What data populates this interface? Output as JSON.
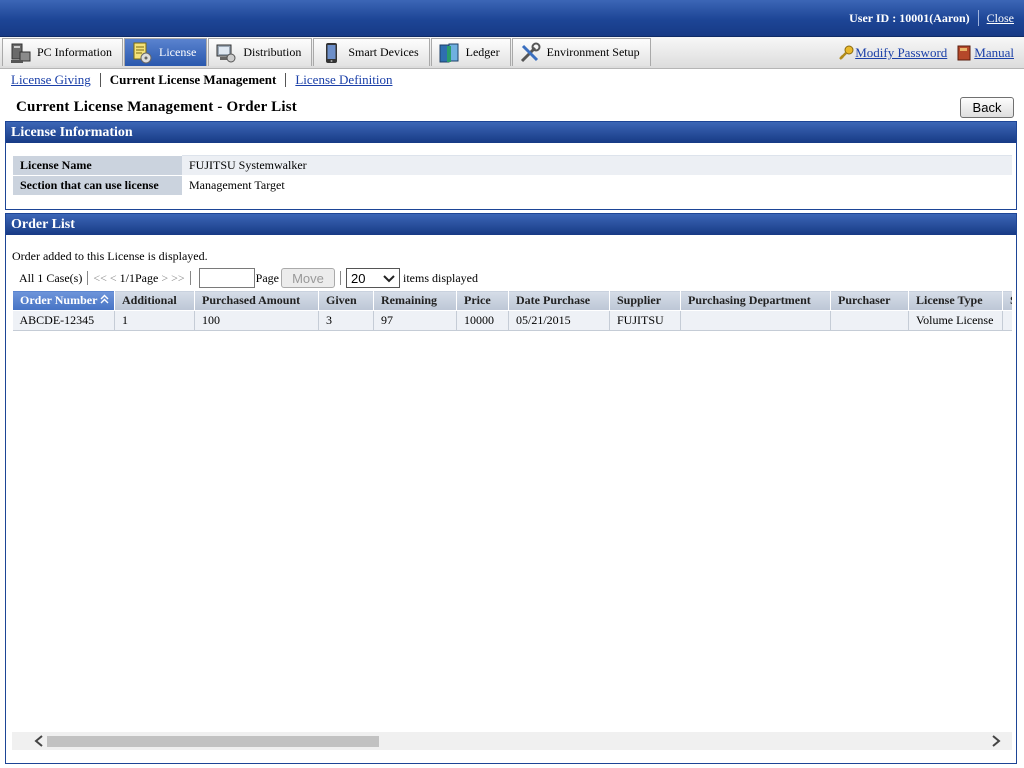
{
  "header": {
    "user_id": "User ID : 10001(Aaron)",
    "close": "Close"
  },
  "nav": {
    "tabs": [
      {
        "label": "PC Information",
        "icon": "pc-icon"
      },
      {
        "label": "License",
        "icon": "license-icon"
      },
      {
        "label": "Distribution",
        "icon": "distribution-icon"
      },
      {
        "label": "Smart Devices",
        "icon": "smartphone-icon"
      },
      {
        "label": "Ledger",
        "icon": "ledger-icon"
      },
      {
        "label": "Environment Setup",
        "icon": "tools-icon"
      }
    ],
    "active_tab": "License",
    "modify_password": "Modify Password",
    "manual": "Manual"
  },
  "subnav": {
    "license_giving": "License Giving",
    "current": "Current License Management",
    "license_definition": "License Definition"
  },
  "page": {
    "title": "Current License Management - Order List",
    "back": "Back"
  },
  "license_info": {
    "heading": "License Information",
    "rows": [
      {
        "key": "License Name",
        "value": "FUJITSU Systemwalker"
      },
      {
        "key": "Section that can use license",
        "value": "Management Target"
      }
    ]
  },
  "order_list": {
    "heading": "Order List",
    "description": "Order added to this License is displayed.",
    "pager": {
      "all_cases": "All 1 Case(s)",
      "first": "<<",
      "prev": "<",
      "page_info": "1/1Page",
      "next": ">",
      "last": ">>",
      "page_label": "Page",
      "move": "Move",
      "per_page": "20",
      "items_label": "items displayed"
    },
    "columns": [
      "Order Number",
      "Additional",
      "Purchased Amount",
      "Given",
      "Remaining",
      "Price",
      "Date Purchase",
      "Supplier",
      "Purchasing Department",
      "Purchaser",
      "License Type",
      "S"
    ],
    "rows": [
      [
        "ABCDE-12345",
        "1",
        "100",
        "3",
        "97",
        "10000",
        "05/21/2015",
        "FUJITSU",
        "",
        "",
        "Volume License",
        ""
      ]
    ]
  },
  "colors": {
    "header_blue": "#1d4596",
    "tab_active": "#2a58ad",
    "link": "#1a3fa8"
  }
}
